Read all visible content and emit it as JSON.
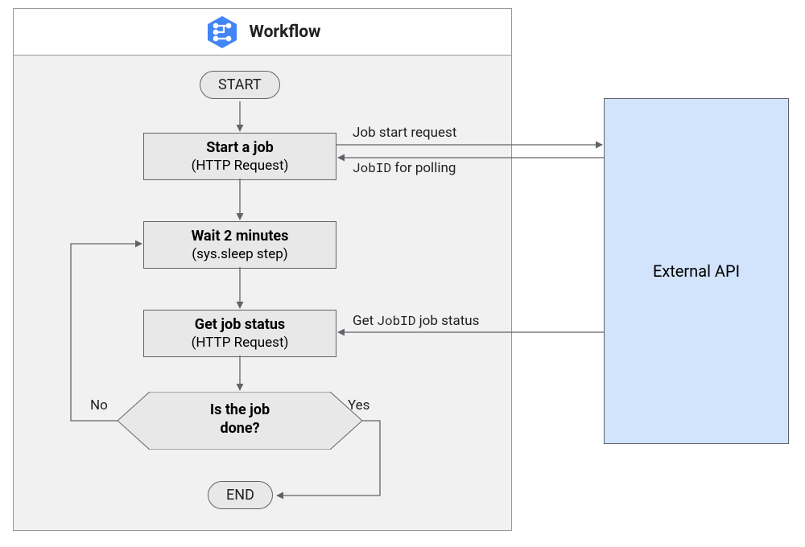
{
  "workflow": {
    "title": "Workflow",
    "start": "START",
    "end": "END",
    "steps": {
      "startJob": {
        "title": "Start a job",
        "sub": "(HTTP Request)"
      },
      "wait": {
        "title": "Wait 2 minutes",
        "sub": "(sys.sleep step)"
      },
      "getStatus": {
        "title": "Get job status",
        "sub": "(HTTP Request)"
      },
      "decision": {
        "line1": "Is the job",
        "line2": "done?"
      }
    },
    "edgeLabels": {
      "no": "No",
      "yes": "Yes",
      "jobStartReq": "Job start request",
      "jobIdPoll_pre": "JobID",
      "jobIdPoll_post": " for polling",
      "getJobStatus_pre": "Get ",
      "getJobStatus_mid": "JobID",
      "getJobStatus_post": " job status"
    }
  },
  "external": {
    "title": "External API"
  }
}
